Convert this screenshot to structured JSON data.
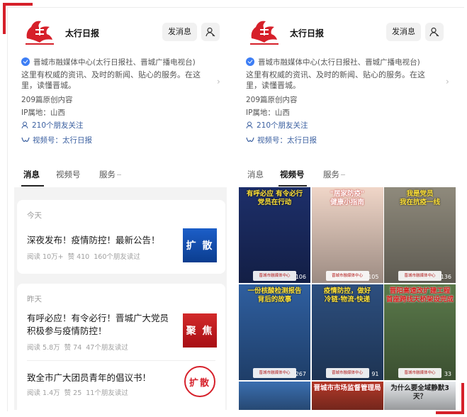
{
  "account": {
    "name": "太行日报",
    "follow_label": "发消息",
    "org": "晋城市融媒体中心(太行日报社、晋城广播电视台)",
    "description": "这里有权威的资讯、及时的新闻、贴心的服务。在这里，读懂晋城。",
    "original_count": "209篇原创内容",
    "ip": "IP属地：山西",
    "friends": "210个朋友关注",
    "channel": "视频号：太行日报"
  },
  "tabs": [
    {
      "label": "消息"
    },
    {
      "label": "视频号"
    },
    {
      "label": "服务"
    }
  ],
  "left_feed": {
    "today_label": "今天",
    "yesterday_label": "昨天",
    "articles": [
      {
        "title": "深夜发布！疫情防控！最新公告！",
        "reads": "阅读 10万+",
        "likes": "赞 410",
        "friends": "160个朋友读过",
        "thumb_text": "扩 散",
        "thumb_style": "blue"
      },
      {
        "title": "有呼必应！有令必行！晋城广大党员积极参与疫情防控！",
        "reads": "阅读 5.8万",
        "likes": "赞 74",
        "friends": "47个朋友读过",
        "thumb_text": "聚 焦",
        "thumb_style": "red"
      },
      {
        "title": "致全市广大团员青年的倡议书！",
        "reads": "阅读 1.4万",
        "likes": "赞 25",
        "friends": "11个朋友读过",
        "thumb_text": "扩散",
        "thumb_style": "seal"
      }
    ]
  },
  "videos": [
    {
      "caption": "有呼必应 有令必行\n党员在行动",
      "count": "106",
      "bg": "#1d2f6a",
      "cap_class": "cap-yellow"
    },
    {
      "caption": "\"居家防疫\"\n健康小指南",
      "count": "105",
      "bg": "#f0d6c8",
      "cap_class": "cap-white"
    },
    {
      "caption": "我是党员\n我在抗疫一线",
      "count": "136",
      "bg": "#8f8a7c",
      "cap_class": "cap-yellow"
    },
    {
      "caption": "一份核酸检测报告\n背后的故事",
      "count": "267",
      "bg": "#2f5fa0",
      "cap_class": "cap-yellow"
    },
    {
      "caption": "疫情防控，做好\n冷链·物流·快递",
      "count": "91",
      "bg": "#2d4f7f",
      "cap_class": "cap-yellow"
    },
    {
      "caption": "晋阳高速改扩建工程\n首座跨线天桥架设完成",
      "count": "33",
      "bg": "#5b7a4b",
      "cap_class": "cap-red"
    },
    {
      "caption": "",
      "count": "",
      "bg": "#3b6fb0",
      "cap_class": "cap-white"
    },
    {
      "caption": "晋城市市场监督管理局",
      "count": "",
      "bg": "#b23a2a",
      "cap_class": "cap-white"
    },
    {
      "caption": "为什么要全域静默3天？",
      "count": "",
      "bg": "#e9ecef",
      "cap_class": "cap-dark"
    }
  ],
  "video_badge": "晋城市融媒体中心",
  "colors": {
    "accent": "#d6202a",
    "link": "#3a5fa0",
    "verify": "#3d7ef5"
  }
}
